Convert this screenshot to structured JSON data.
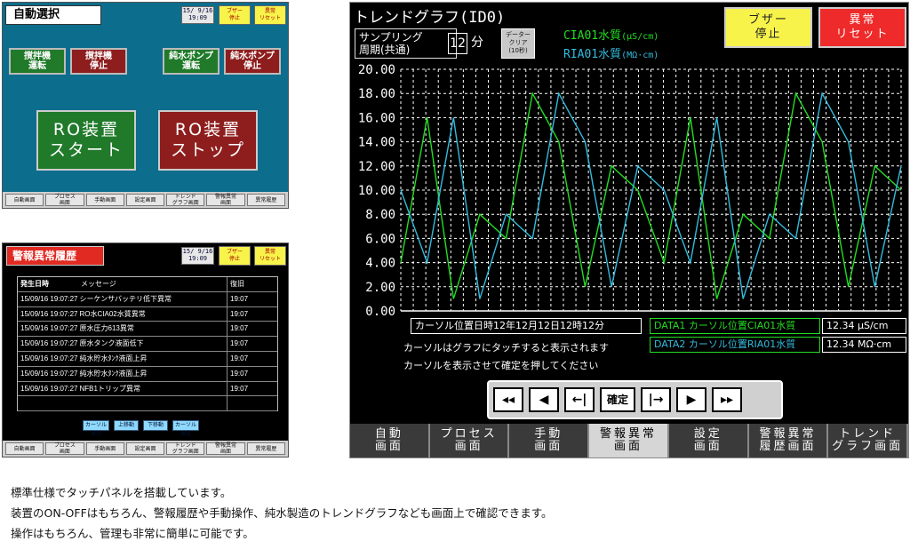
{
  "auto_panel": {
    "title": "自動選択",
    "stamp": [
      "15/ 9/16",
      "19:09"
    ],
    "buzzer_small": [
      "ブザー",
      "停止"
    ],
    "reset_small": [
      "異常",
      "リセット"
    ],
    "buttons": [
      {
        "l1": "撹拌機",
        "l2": "運転"
      },
      {
        "l1": "撹拌機",
        "l2": "停止"
      },
      {
        "l1": "純水ポンプ",
        "l2": "運転"
      },
      {
        "l1": "純水ポンプ",
        "l2": "停止"
      }
    ],
    "ro_start": [
      "RO装置",
      "スタート"
    ],
    "ro_stop": [
      "RO装置",
      "ストップ"
    ],
    "nav": [
      "自動画面",
      "プロセス\n画面",
      "手動画面",
      "設定画面",
      "トレンド\nグラフ画面",
      "警報異常\n画面",
      "異常履歴"
    ]
  },
  "alarm_panel": {
    "title": "警報異常履歴",
    "stamp": [
      "15/ 9/16",
      "19:09"
    ],
    "buzzer_small": [
      "ブザー",
      "停止"
    ],
    "reset_small": [
      "異常",
      "リセット"
    ],
    "header": {
      "time": "発生日時",
      "msg": "メッセージ",
      "rec": "復旧"
    },
    "rows": [
      {
        "time": "15/09/16 19:07:27",
        "msg": "シーケンサバッテリ低下異常",
        "rec": "19:07"
      },
      {
        "time": "15/09/16 19:07:27",
        "msg": "RO水CIA02水質異常",
        "rec": "19:07"
      },
      {
        "time": "15/09/16 19:07:27",
        "msg": "原水圧力613異常",
        "rec": "19:07"
      },
      {
        "time": "15/09/16 19:07:27",
        "msg": "原水タンク液面低下",
        "rec": "19:07"
      },
      {
        "time": "15/09/16 19:07:27",
        "msg": "純水貯水ﾀﾝｸ液面上昇",
        "rec": "19:07"
      },
      {
        "time": "15/09/16 19:07:27",
        "msg": "純水貯水ﾀﾝｸ液面上昇",
        "rec": "19:07"
      },
      {
        "time": "15/09/16 19:07:27",
        "msg": "NFB1トリップ異常",
        "rec": "19:07"
      },
      {
        "time": "",
        "msg": "",
        "rec": ""
      }
    ],
    "cursor_buttons": [
      "カーソル表示",
      "上移動",
      "下移動",
      "カーソル確定"
    ],
    "nav": [
      "自動画面",
      "プロセス\n画面",
      "手動画面",
      "設定画面",
      "トレンド\nグラフ画面",
      "警報異常\n画面",
      "異常履歴"
    ]
  },
  "trend_panel": {
    "title": "トレンドグラフ(ID0)",
    "sampling_label": [
      "サンプリング",
      "周期(共通)"
    ],
    "sampling_value": "12",
    "sampling_unit": "分",
    "data_clear": [
      "データー",
      "クリア",
      "(10秒)"
    ],
    "legend1": "CIA01水質",
    "legend1_unit": "(μS/cm)",
    "legend2": "RIA01水質",
    "legend2_unit": "(MΩ·cm)",
    "buzzer": [
      "ブザー",
      "停止"
    ],
    "reset": [
      "異常",
      "リセット"
    ],
    "cursor_datetime": "カーソル位置日時12年12月12日12時12分",
    "note1": "カーソルはグラフにタッチすると表示されます",
    "note2": "カーソルを表示させて確定を押してください",
    "data1_label": "DATA1 カーソル位置CIA01水質",
    "data1_value": "12.34 μS/cm",
    "data2_label": "DATA2 カーソル位置RIA01水質",
    "data2_value": "12.34 MΩ·cm",
    "cursor_buttons": [
      "◂◂",
      "◀",
      "←|",
      "確定",
      "|→",
      "▶",
      "▸▸"
    ],
    "nav": [
      "自動\n画面",
      "プロセス\n画面",
      "手動\n画面",
      "警報異常\n画面",
      "設定\n画面",
      "警報異常\n履歴画面",
      "トレンド\nグラフ画面"
    ],
    "colors": {
      "series1": "#22dd22",
      "series2": "#33bbdd",
      "grid": "#ffffff"
    }
  },
  "chart_data": {
    "type": "line",
    "ylim": [
      0,
      20
    ],
    "yticks": [
      "0.00",
      "2.00",
      "4.00",
      "6.00",
      "8.00",
      "10.00",
      "12.00",
      "14.00",
      "16.00",
      "18.00",
      "20.00"
    ],
    "x": [
      0,
      1,
      2,
      3,
      4,
      5,
      6,
      7,
      8,
      9,
      10,
      11,
      12,
      13,
      14,
      15,
      16,
      17,
      18,
      19,
      20,
      21,
      22,
      23,
      24,
      25,
      26,
      27,
      28,
      29,
      30,
      31,
      32,
      33,
      34,
      35,
      36,
      37,
      38,
      39,
      40
    ],
    "series": [
      {
        "name": "CIA01水質",
        "values": [
          4,
          16,
          1,
          8,
          6,
          18,
          14,
          2,
          12,
          10,
          4,
          16,
          1,
          8,
          6,
          18,
          14,
          2,
          12,
          10
        ]
      },
      {
        "name": "RIA01水質",
        "values": [
          10,
          4,
          16,
          1,
          8,
          6,
          18,
          14,
          2,
          12,
          10,
          4,
          16,
          1,
          8,
          6,
          18,
          14,
          2,
          12
        ]
      }
    ]
  },
  "caption": [
    "標準仕様でタッチパネルを搭載しています。",
    "装置のON-OFFはもちろん、警報履歴や手動操作、純水製造のトレンドグラフなども画面上で確認できます。",
    "操作はもちろん、管理も非常に簡単に可能です。"
  ]
}
